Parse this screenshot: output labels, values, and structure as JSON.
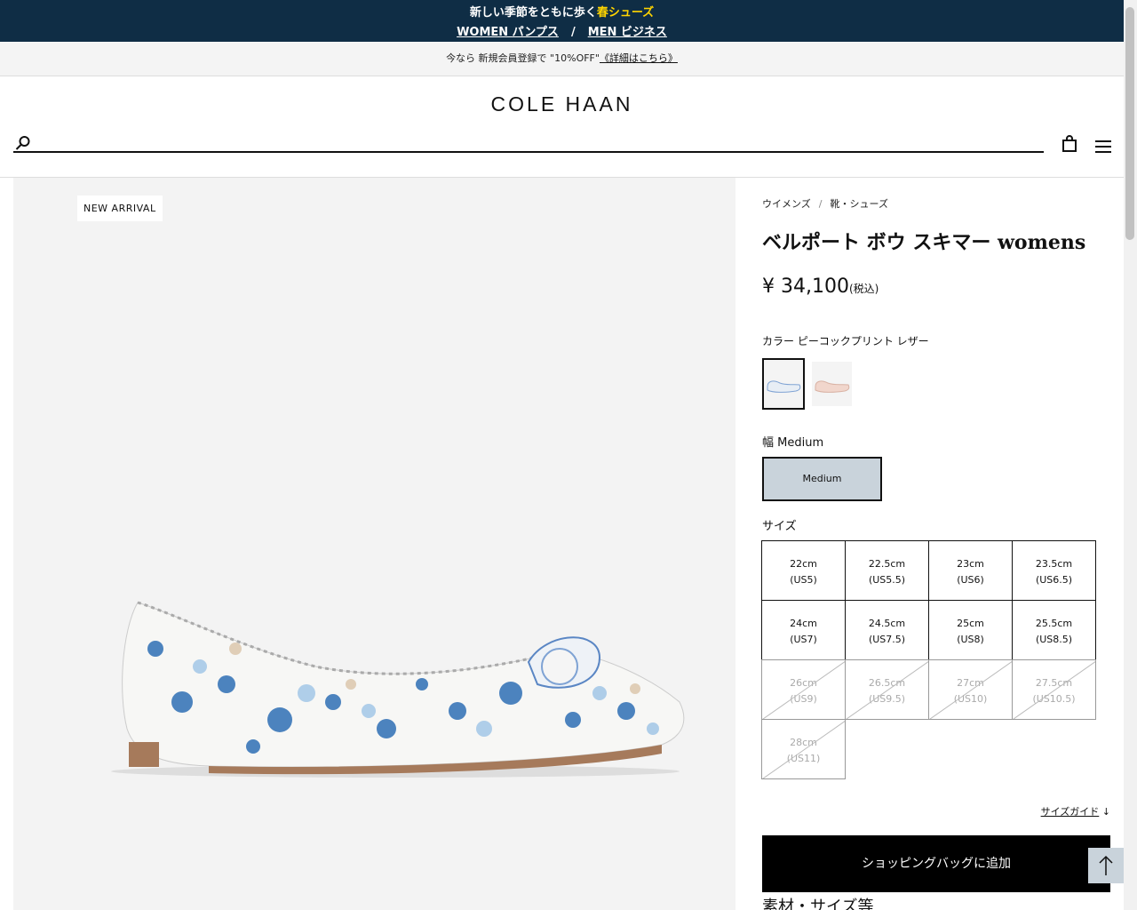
{
  "promo": {
    "line1_text": "新しい季節をともに歩く",
    "line1_highlight": "春シューズ",
    "link_women": "WOMEN パンプス",
    "separator": "/",
    "link_men": "MEN ビジネス",
    "bg_color": "#0f2d45",
    "highlight_color": "#ffd400"
  },
  "member_bar": {
    "text": "今なら 新規会員登録で \"10%OFF\"",
    "link": "《詳細はこちら》"
  },
  "header": {
    "logo": "COLE HAAN",
    "search_placeholder": "",
    "icons": [
      "search-icon",
      "bag-icon",
      "menu-icon"
    ]
  },
  "gallery": {
    "badge": "NEW ARRIVAL"
  },
  "product": {
    "breadcrumb": [
      "ウイメンズ",
      "靴・シューズ"
    ],
    "breadcrumb_sep": "/",
    "title": "ベルポート ボウ スキマー womens",
    "price": "¥ 34,100",
    "price_tax": "(税込)",
    "color_label": "カラー ピーコックプリント レザー",
    "width_label": "幅 Medium",
    "width_option": "Medium",
    "size_label": "サイズ",
    "sizes": [
      {
        "cm": "22cm",
        "us": "(US5)",
        "available": true
      },
      {
        "cm": "22.5cm",
        "us": "(US5.5)",
        "available": true
      },
      {
        "cm": "23cm",
        "us": "(US6)",
        "available": true
      },
      {
        "cm": "23.5cm",
        "us": "(US6.5)",
        "available": true
      },
      {
        "cm": "24cm",
        "us": "(US7)",
        "available": true
      },
      {
        "cm": "24.5cm",
        "us": "(US7.5)",
        "available": true
      },
      {
        "cm": "25cm",
        "us": "(US8)",
        "available": true
      },
      {
        "cm": "25.5cm",
        "us": "(US8.5)",
        "available": true
      },
      {
        "cm": "26cm",
        "us": "(US9)",
        "available": false
      },
      {
        "cm": "26.5cm",
        "us": "(US9.5)",
        "available": false
      },
      {
        "cm": "27cm",
        "us": "(US10)",
        "available": false
      },
      {
        "cm": "27.5cm",
        "us": "(US10.5)",
        "available": false
      },
      {
        "cm": "28cm",
        "us": "(US11)",
        "available": false
      }
    ],
    "size_guide": "サイズガイド",
    "size_guide_arrow": "↓",
    "add_to_bag": "ショッピングバッグに追加",
    "material_heading": "素材・サイズ等",
    "selected_width_color": "#c9d3db"
  }
}
